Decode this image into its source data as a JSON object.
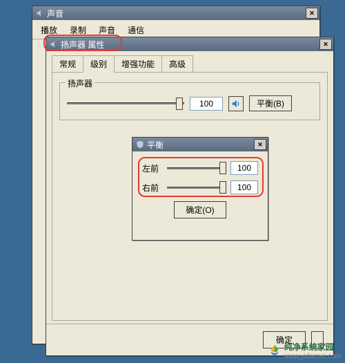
{
  "soundWindow": {
    "title": "声音",
    "tabs": [
      "播放",
      "录制",
      "声音",
      "通信"
    ]
  },
  "propWindow": {
    "title": "扬声器 属性",
    "tabs": [
      {
        "label": "常规"
      },
      {
        "label": "级别"
      },
      {
        "label": "增强功能"
      },
      {
        "label": "高级"
      }
    ],
    "activeTab": "级别",
    "speakerGroup": {
      "legend": "扬声器",
      "value": "100",
      "balanceBtn": "平衡(B)"
    },
    "okBtn": "确定"
  },
  "balanceWindow": {
    "title": "平衡",
    "rows": [
      {
        "label": "左前",
        "value": "100"
      },
      {
        "label": "右前",
        "value": "100"
      }
    ],
    "okBtn": "确定(O)"
  },
  "icons": {
    "speaker": "speaker-icon",
    "shield": "shield-icon"
  },
  "watermark": {
    "text": "纯净系统家园",
    "url": "www.yidaimei.com"
  }
}
